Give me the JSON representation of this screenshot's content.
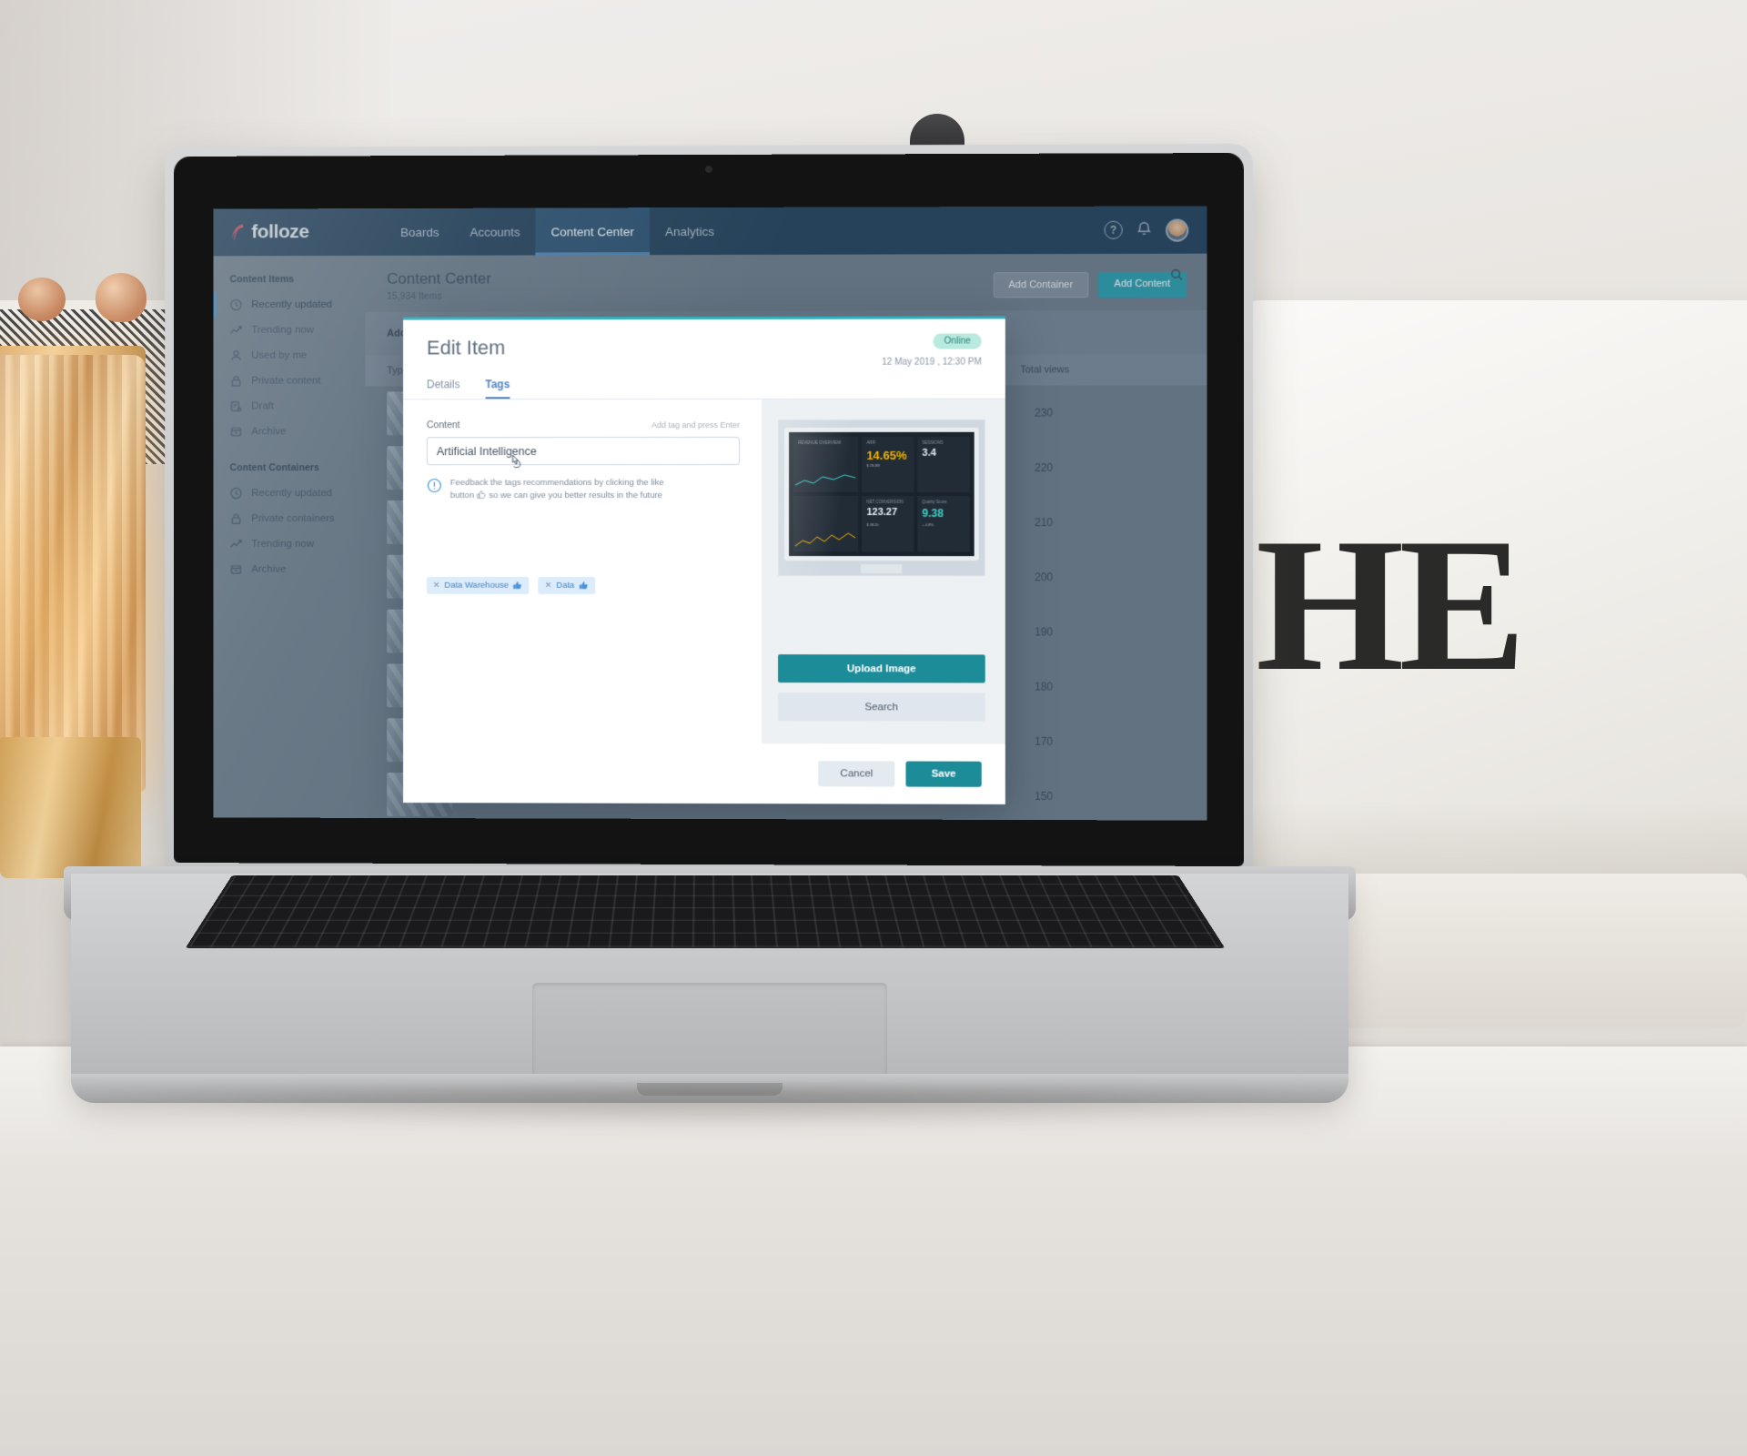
{
  "topnav": {
    "brand": "folloze",
    "items": [
      {
        "label": "Boards",
        "active": false
      },
      {
        "label": "Accounts",
        "active": false
      },
      {
        "label": "Content Center",
        "active": true
      },
      {
        "label": "Analytics",
        "active": false
      }
    ],
    "help_icon": "?",
    "bell_icon": "notification-bell"
  },
  "sidebar": {
    "section1_title": "Content Items",
    "section1_items": [
      {
        "label": "Recently updated",
        "icon": "clock-icon",
        "active": true
      },
      {
        "label": "Trending now",
        "icon": "trending-up-icon",
        "active": false
      },
      {
        "label": "Used by me",
        "icon": "user-icon",
        "active": false
      },
      {
        "label": "Private content",
        "icon": "lock-icon",
        "active": false
      },
      {
        "label": "Draft",
        "icon": "draft-icon",
        "active": false
      },
      {
        "label": "Archive",
        "icon": "archive-icon",
        "active": false
      }
    ],
    "section2_title": "Content Containers",
    "section2_items": [
      {
        "label": "Recently updated",
        "icon": "clock-icon"
      },
      {
        "label": "Private containers",
        "icon": "lock-icon"
      },
      {
        "label": "Trending now",
        "icon": "trending-up-icon"
      },
      {
        "label": "Archive",
        "icon": "archive-icon"
      }
    ]
  },
  "page": {
    "title": "Content Center",
    "subtitle": "15,934 Items",
    "add_container_label": "Add Container",
    "add_content_label": "Add Content",
    "filter_label": "Add by a",
    "search_icon": "search-icon"
  },
  "table": {
    "col_type": "Type",
    "col_total_views": "Total views",
    "rows": [
      {
        "views": "230"
      },
      {
        "views": "220"
      },
      {
        "views": "210"
      },
      {
        "views": "200"
      },
      {
        "views": "190"
      },
      {
        "views": "180"
      },
      {
        "views": "170"
      },
      {
        "views": "150"
      }
    ]
  },
  "modal": {
    "title": "Edit Item",
    "status_badge": "Online",
    "date": "12 May 2019 , 12:30 PM",
    "tabs": [
      {
        "label": "Details",
        "active": false
      },
      {
        "label": "Tags",
        "active": true
      }
    ],
    "content_label": "Content",
    "content_hint": "Add tag and press Enter",
    "content_value": "Artificial Intelligence",
    "feedback_line1": "Feedback the tags recommendations by clicking the like",
    "feedback_line2_a": "button",
    "feedback_line2_b": "so we can give you better results in the future",
    "feedback_icon": "info-circle-icon",
    "like_icon": "thumbs-up-icon",
    "chips": [
      {
        "label": "Data Warehouse",
        "remove_icon": "close-icon",
        "like_icon": "thumbs-up-icon"
      },
      {
        "label": "Data",
        "remove_icon": "close-icon",
        "like_icon": "thumbs-up-icon"
      }
    ],
    "upload_label": "Upload Image",
    "search_label": "Search",
    "cancel_label": "Cancel",
    "save_label": "Save",
    "preview": {
      "cells": [
        {
          "mini": "REVENUE OVERVIEW",
          "value": "",
          "sub": ""
        },
        {
          "mini": "ARR",
          "value": "14.65%",
          "sub": "$ 28.3M"
        },
        {
          "mini": "SESSIONS",
          "value": "3.4",
          "sub": ""
        },
        {
          "mini": "NET CONVERSION",
          "value": "123.27",
          "sub": "$ 38.20"
        },
        {
          "mini": "Quality Score",
          "value": "9.38",
          "sub": "+ 4.8%"
        }
      ]
    }
  },
  "colors": {
    "accent_teal": "#1d8c99",
    "nav_blue": "#26455e",
    "tab_blue": "#4a7fc1",
    "badge_green": "#b8eadf",
    "modal_top_border": "#2fb0bd"
  },
  "scene": {
    "pillow_text": "HE"
  }
}
